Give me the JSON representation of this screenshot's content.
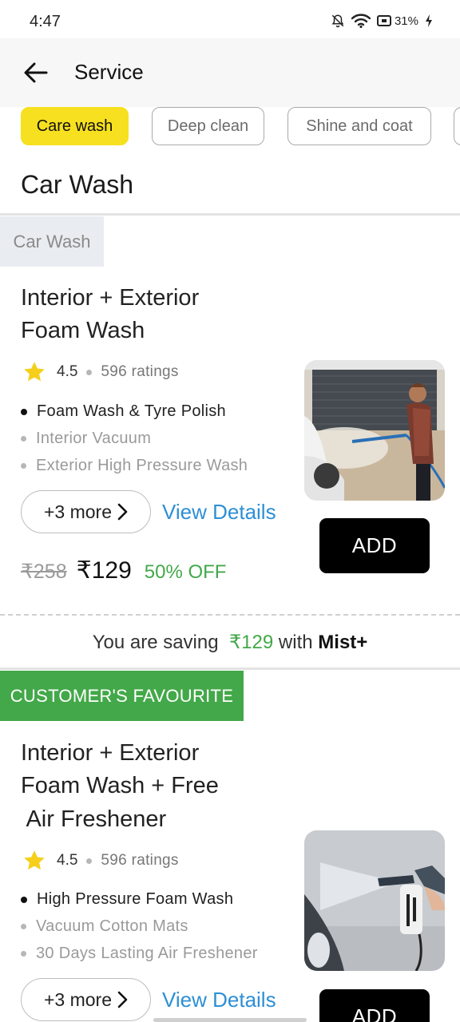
{
  "status_bar": {
    "time": "4:47",
    "battery": "31%"
  },
  "header": {
    "title": "Service"
  },
  "filters": [
    {
      "label": "Care wash",
      "active": true
    },
    {
      "label": "Deep clean",
      "active": false
    },
    {
      "label": "Shine and coat",
      "active": false
    },
    {
      "label": "",
      "active": false
    }
  ],
  "section_title": "Car Wash",
  "services": [
    {
      "tag": "Car Wash",
      "title_lines": [
        "Interior + Exterior",
        "Foam Wash"
      ],
      "rating": "4.5",
      "ratings_count": "596 ratings",
      "features": [
        "Foam Wash & Tyre Polish",
        "Interior Vacuum",
        "Exterior High Pressure Wash"
      ],
      "more_label": "+3 more",
      "view_details": "View Details",
      "add_label": "ADD",
      "mrp": "₹258",
      "price": "₹129",
      "discount": "50% OFF",
      "saving": {
        "prefix": "You are saving",
        "amount": "₹129",
        "mid": "with",
        "brand": "Mist+"
      }
    },
    {
      "tag": "CUSTOMER'S FAVOURITE",
      "title_lines": [
        "Interior + Exterior",
        "Foam Wash + Free",
        " Air Freshener"
      ],
      "rating": "4.5",
      "ratings_count": "596 ratings",
      "features": [
        "High Pressure Foam Wash",
        "Vacuum Cotton Mats",
        "30 Days Lasting Air Freshener"
      ],
      "more_label": "+3 more",
      "view_details": "View Details",
      "add_label": "ADD"
    }
  ],
  "colors": {
    "accent_yellow": "#f7e01f",
    "green": "#43a849",
    "link_blue": "#2d8fd5"
  }
}
